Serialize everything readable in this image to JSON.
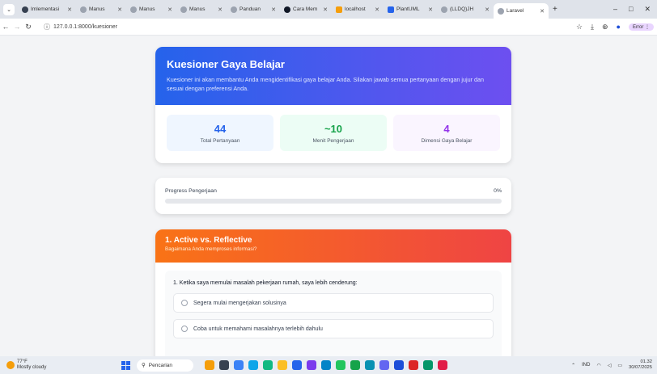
{
  "browser": {
    "tabs": [
      {
        "label": "Imlementasi",
        "icon": "chrome-icon",
        "active": false
      },
      {
        "label": "Manus",
        "icon": "manus-icon",
        "active": false
      },
      {
        "label": "Manus",
        "icon": "manus-icon",
        "active": false
      },
      {
        "label": "Manus",
        "icon": "manus-icon",
        "active": false
      },
      {
        "label": "Panduan",
        "icon": "manus-icon",
        "active": false
      },
      {
        "label": "Cara Mem",
        "icon": "chrome-icon",
        "active": false
      },
      {
        "label": "localhost",
        "icon": "database-icon",
        "active": false
      },
      {
        "label": "PlantUML",
        "icon": "plantuml-icon",
        "active": false
      },
      {
        "label": "(LLDQ)JH",
        "icon": "manus-icon",
        "active": false
      },
      {
        "label": "Laravel",
        "icon": "laravel-icon",
        "active": true
      }
    ],
    "url": "127.0.0.1:8000/kuesioner",
    "error_label": "Error"
  },
  "hero": {
    "title": "Kuesioner Gaya Belajar",
    "description": "Kuesioner ini akan membantu Anda mengidentifikasi gaya belajar Anda. Silakan jawab semua pertanyaan dengan jujur dan sesuai dengan preferensi Anda.",
    "stats": [
      {
        "value": "44",
        "label": "Total Pertanyaan"
      },
      {
        "value": "~10",
        "label": "Menit Pengerjaan"
      },
      {
        "value": "4",
        "label": "Dimensi Gaya Belajar"
      }
    ]
  },
  "progress": {
    "label": "Progress Pengerjaan",
    "percent_text": "0%",
    "value": 0
  },
  "section": {
    "title": "1. Active vs. Reflective",
    "subtitle": "Bagaimana Anda memproses informasi?",
    "question": "1. Ketika saya memulai masalah pekerjaan rumah, saya lebih cenderung:",
    "options": [
      "Segera mulai mengerjakan solusinya",
      "Coba untuk memahami masalahnya terlebih dahulu"
    ]
  },
  "taskbar": {
    "temperature": "77°F",
    "weather": "Mostly cloudy",
    "search_placeholder": "Pencarian",
    "language": "IND",
    "time": "01.32",
    "date": "30/07/2025"
  },
  "colors": {
    "hero_gradient": [
      "#2563eb",
      "#6d4ff0"
    ],
    "section_gradient": [
      "#f97316",
      "#ef4444"
    ]
  }
}
